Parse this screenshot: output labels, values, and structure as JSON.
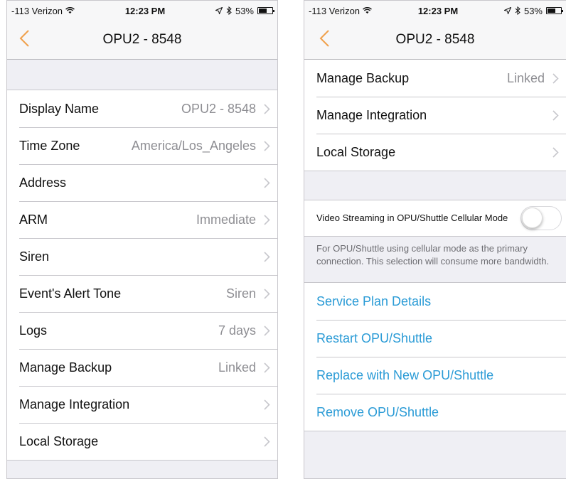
{
  "status": {
    "carrier": "-113 Verizon",
    "time": "12:23 PM",
    "battery": "53%"
  },
  "nav": {
    "title": "OPU2 - 8548"
  },
  "colors": {
    "accent": "#f0a04b",
    "link": "#2a9bd6"
  },
  "left_rows": [
    {
      "label": "Display Name",
      "value": "OPU2 - 8548"
    },
    {
      "label": "Time Zone",
      "value": "America/Los_Angeles"
    },
    {
      "label": "Address",
      "value": ""
    },
    {
      "label": "ARM",
      "value": "Immediate"
    },
    {
      "label": "Siren",
      "value": ""
    },
    {
      "label": "Event's Alert Tone",
      "value": "Siren"
    },
    {
      "label": "Logs",
      "value": "7 days"
    },
    {
      "label": "Manage Backup",
      "value": "Linked"
    },
    {
      "label": "Manage Integration",
      "value": ""
    },
    {
      "label": "Local Storage",
      "value": ""
    }
  ],
  "right_rows": [
    {
      "label": "Manage Backup",
      "value": "Linked"
    },
    {
      "label": "Manage Integration",
      "value": ""
    },
    {
      "label": "Local Storage",
      "value": ""
    }
  ],
  "video_streaming": {
    "label": "Video Streaming in OPU/Shuttle Cellular Mode",
    "enabled": false,
    "note": "For OPU/Shuttle using cellular mode as the primary connection. This selection will consume more bandwidth."
  },
  "actions": [
    "Service Plan Details",
    "Restart OPU/Shuttle",
    "Replace with New OPU/Shuttle",
    "Remove OPU/Shuttle"
  ]
}
